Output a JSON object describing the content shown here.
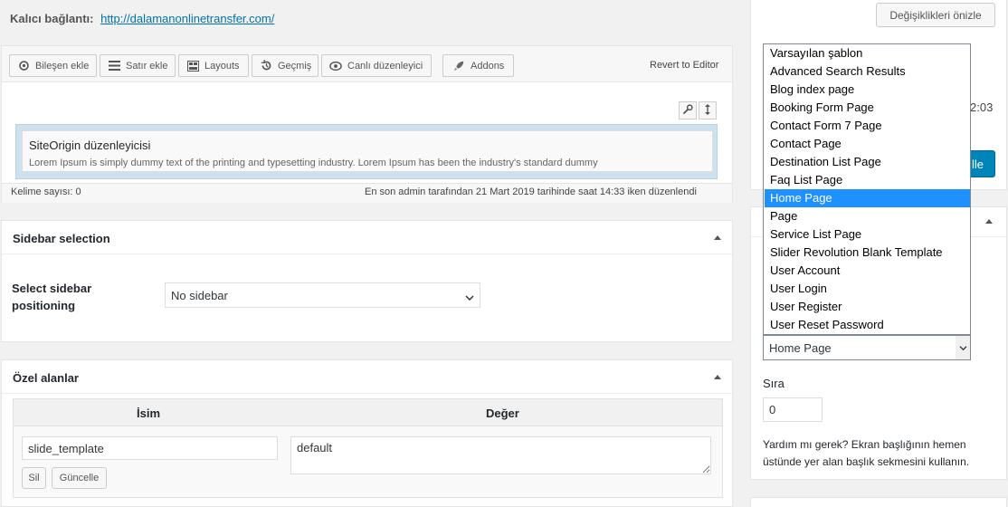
{
  "permalink": {
    "label": "Kalıcı bağlantı:",
    "url": "http://dalamanonlinetransfer.com/"
  },
  "toolbar": {
    "add_widget": "Bileşen ekle",
    "add_row": "Satır ekle",
    "layouts": "Layouts",
    "history": "Geçmiş",
    "live_editor": "Canlı düzenleyici",
    "addons": "Addons",
    "revert": "Revert to Editor"
  },
  "builder": {
    "widget_title": "SiteOrigin düzenleyicisi",
    "widget_excerpt": "Lorem Ipsum is simply dummy text of the printing and typesetting industry. Lorem Ipsum has been the industry's standard dummy"
  },
  "status": {
    "word_count": "Kelime sayısı: 0",
    "last_edited": "En son admin tarafından 21 Mart 2019 tarihinde saat 14:33 iken düzenlendi"
  },
  "sidebar_selection": {
    "title": "Sidebar selection",
    "label": "Select sidebar positioning",
    "value": "No sidebar"
  },
  "custom_fields": {
    "title": "Özel alanlar",
    "col_name": "İsim",
    "col_value": "Değer",
    "name_value": "slide_template",
    "value_value": "default",
    "delete_label": "Sil",
    "update_label": "Güncelle"
  },
  "publish": {
    "preview_label": "Değişiklikleri önizle",
    "clock_partial": "2:03",
    "update_partial": "lle"
  },
  "attributes": {
    "template_selected": "Home Page",
    "template_options": [
      "Varsayılan şablon",
      "Advanced Search Results",
      "Blog index page",
      "Booking Form Page",
      "Contact Form 7 Page",
      "Contact Page",
      "Destination List Page",
      "Faq List Page",
      "Home Page",
      "Page",
      "Service List Page",
      "Slider Revolution Blank Template",
      "User Account",
      "User Login",
      "User Register",
      "User Reset Password"
    ],
    "highlighted_index": 8,
    "order_label": "Sıra",
    "order_value": "0",
    "help_text": "Yardım mı gerek? Ekran başlığının hemen üstünde yer alan başlık sekmesini kullanın."
  },
  "colors": {
    "accent": "#0073aa",
    "highlight": "#1e90ff",
    "primary_button": "#0085ba"
  },
  "icons": {
    "add_widget": "gear-icon",
    "add_row": "menu-icon",
    "layouts": "layout-icon",
    "history": "history-icon",
    "live_editor": "eye-icon",
    "addons": "rocket-icon",
    "settings": "wrench-icon",
    "move": "move-icon"
  }
}
